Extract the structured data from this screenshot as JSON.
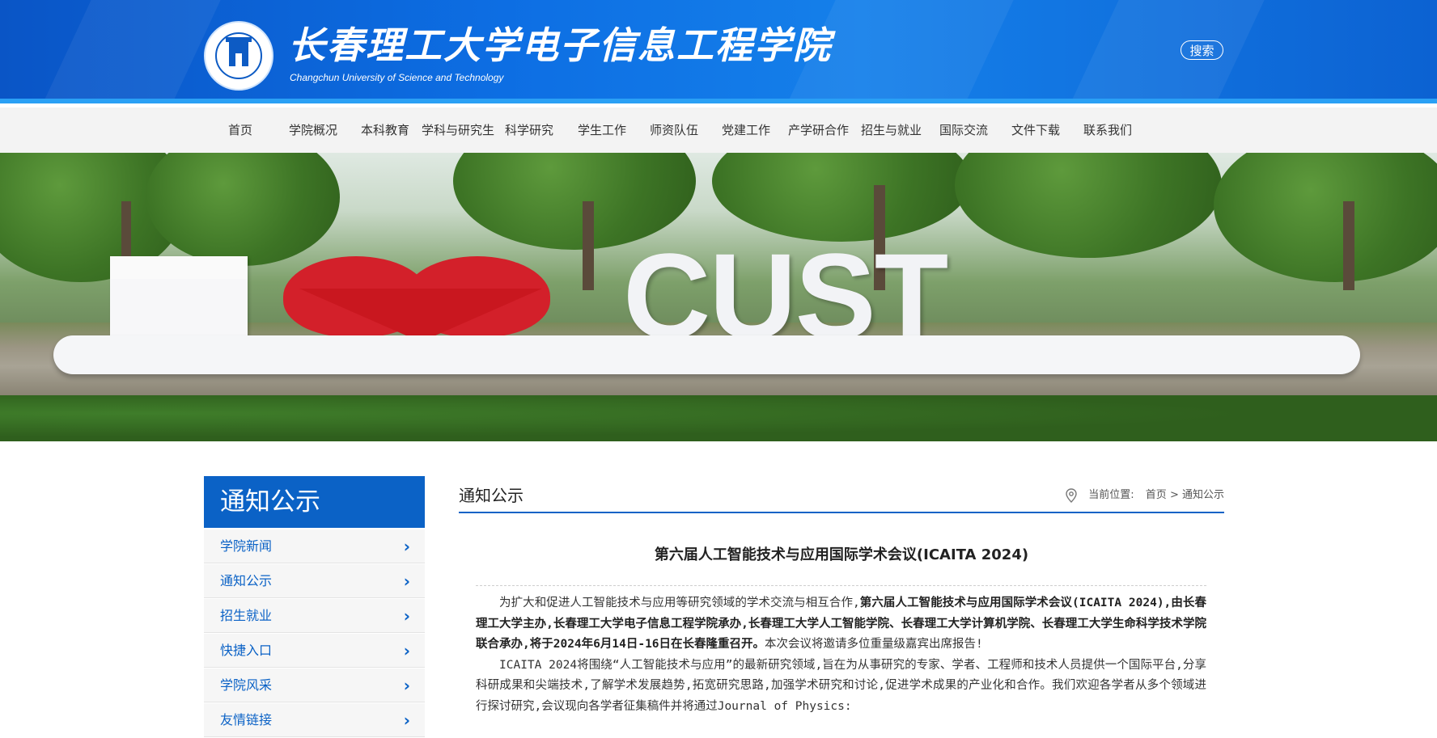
{
  "header": {
    "title": "长春理工大学电子信息工程学院",
    "subtitle": "Changchun University of Science and Technology",
    "search_label": "搜索"
  },
  "nav": {
    "items": [
      "首页",
      "学院概况",
      "本科教育",
      "学科与研究生",
      "科学研究",
      "学生工作",
      "师资队伍",
      "党建工作",
      "产学研合作",
      "招生与就业",
      "国际交流",
      "文件下载",
      "联系我们"
    ]
  },
  "banner": {
    "sign_text": "CUST"
  },
  "sidebar": {
    "heading": "通知公示",
    "items": [
      {
        "label": "学院新闻",
        "arrow": "›"
      },
      {
        "label": "通知公示",
        "arrow": "›"
      },
      {
        "label": "招生就业",
        "arrow": "›"
      },
      {
        "label": "快捷入口",
        "arrow": "›"
      },
      {
        "label": "学院风采",
        "arrow": "›"
      },
      {
        "label": "友情链接",
        "arrow": "›"
      }
    ]
  },
  "content": {
    "section_title": "通知公示",
    "breadcrumb": {
      "prefix": "当前位置:",
      "home": "首页",
      "sep": ">",
      "current": "通知公示"
    },
    "article": {
      "title": "第六届人工智能技术与应用国际学术会议(ICAITA 2024)",
      "p1_intro": "为扩大和促进人工智能技术与应用等研究领域的学术交流与相互合作,",
      "p1_bold": "第六届人工智能技术与应用国际学术会议(ICAITA 2024),由长春理工大学主办,长春理工大学电子信息工程学院承办,长春理工大学人工智能学院、长春理工大学计算机学院、长春理工大学生命科学技术学院联合承办,将于2024年6月14日-16日在长春隆重召开。",
      "p1_tail": "本次会议将邀请多位重量级嘉宾出席报告!",
      "p2": "ICAITA 2024将围绕“人工智能技术与应用”的最新研究领域,旨在为从事研究的专家、学者、工程师和技术人员提供一个国际平台,分享科研成果和尖端技术,了解学术发展趋势,拓宽研究思路,加强学术研究和讨论,促进学术成果的产业化和合作。我们欢迎各学者从多个领域进行探讨研究,会议现向各学者征集稿件并将通过Journal of Physics:"
    }
  },
  "colors": {
    "brand_blue": "#0b62c6",
    "header_blue": "#0d6ee3",
    "heart_red": "#d3202a"
  }
}
